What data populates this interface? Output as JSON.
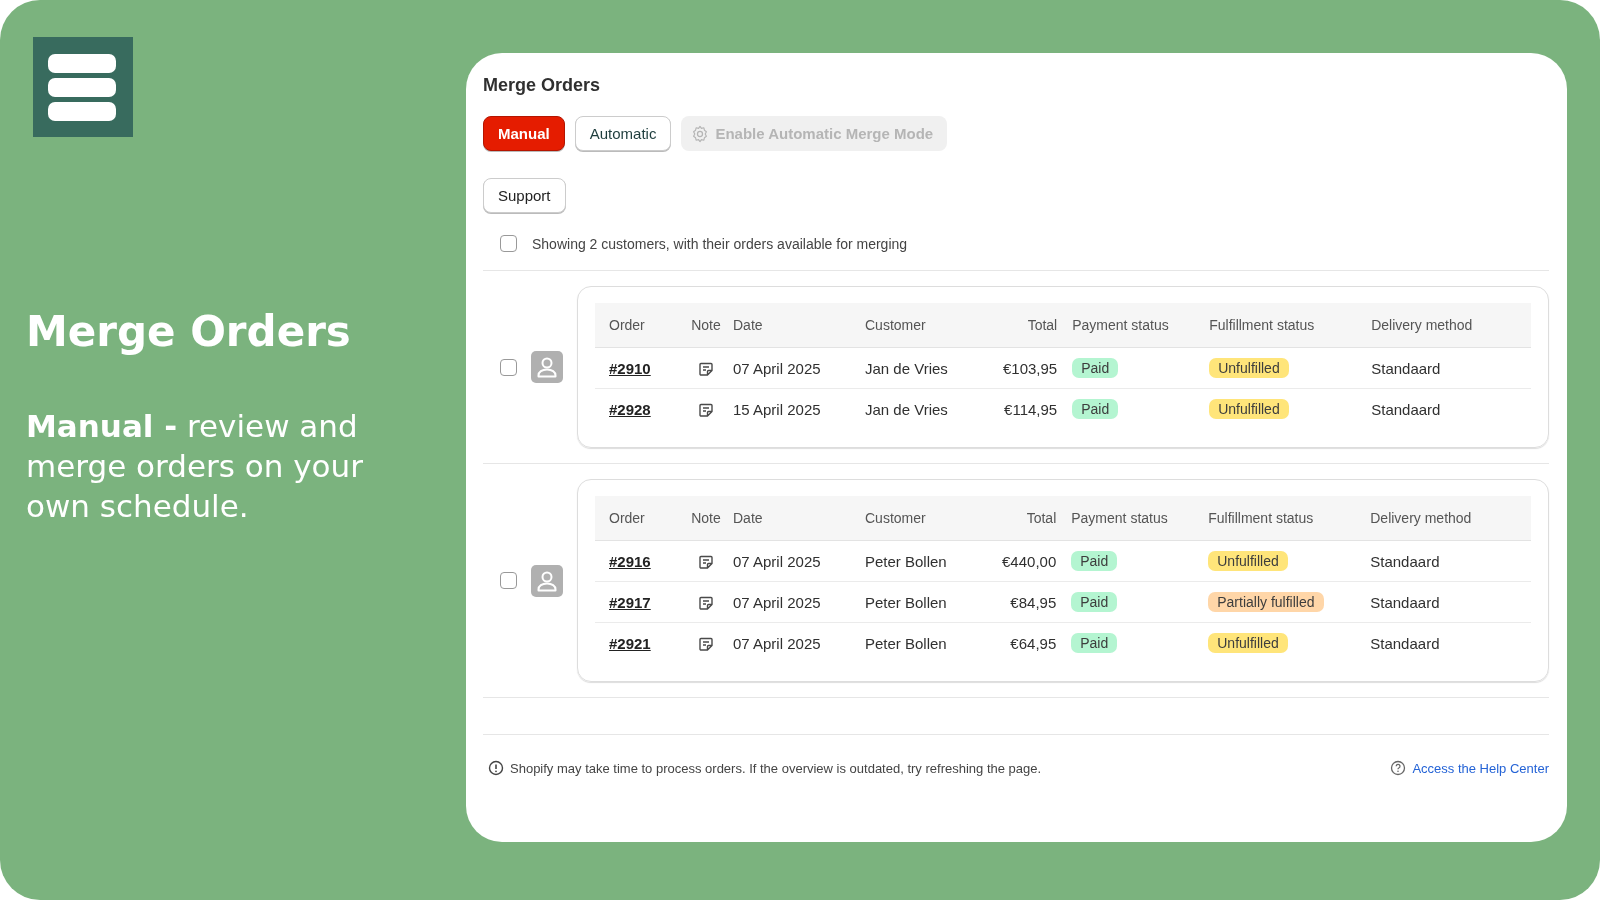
{
  "promo": {
    "title": "Merge Orders",
    "description": "**Manual -** review and merge orders on your own schedule."
  },
  "panel": {
    "title": "Merge Orders",
    "tabs": [
      {
        "label": "Manual",
        "selected": true
      },
      {
        "label": "Automatic",
        "selected": false
      }
    ],
    "enable_button": {
      "label": "Enable Automatic Merge Mode",
      "disabled": true
    },
    "support_button": "Support",
    "select_all": {
      "label": "Showing 2 customers, with their orders available for merging",
      "checked": false
    },
    "groups": [
      {
        "checked": false,
        "columns": [
          "Order",
          "Note",
          "Date",
          "Customer",
          "Total",
          "Payment status",
          "Fulfillment status",
          "Delivery method"
        ],
        "orders": [
          {
            "order": "#2910",
            "date": "07 April 2025",
            "customer": "Jan de Vries",
            "total": "€103,95",
            "payment": {
              "label": "Paid",
              "color": "#b4f5d1"
            },
            "fulfillment": {
              "label": "Unfulfilled",
              "color": "#ffe57a"
            },
            "delivery": "Standaard"
          },
          {
            "order": "#2928",
            "date": "15 April 2025",
            "customer": "Jan de Vries",
            "total": "€114,95",
            "payment": {
              "label": "Paid",
              "color": "#b4f5d1"
            },
            "fulfillment": {
              "label": "Unfulfilled",
              "color": "#ffe57a"
            },
            "delivery": "Standaard"
          }
        ]
      },
      {
        "checked": false,
        "columns": [
          "Order",
          "Note",
          "Date",
          "Customer",
          "Total",
          "Payment status",
          "Fulfillment status",
          "Delivery method"
        ],
        "orders": [
          {
            "order": "#2916",
            "date": "07 April 2025",
            "customer": "Peter Bollen",
            "total": "€440,00",
            "payment": {
              "label": "Paid",
              "color": "#b4f5d1"
            },
            "fulfillment": {
              "label": "Unfulfilled",
              "color": "#ffe57a"
            },
            "delivery": "Standaard"
          },
          {
            "order": "#2917",
            "date": "07 April 2025",
            "customer": "Peter Bollen",
            "total": "€84,95",
            "payment": {
              "label": "Paid",
              "color": "#b4f5d1"
            },
            "fulfillment": {
              "label": "Partially fulfilled",
              "color": "#ffd6a8"
            },
            "delivery": "Standaard"
          },
          {
            "order": "#2921",
            "date": "07 April 2025",
            "customer": "Peter Bollen",
            "total": "€64,95",
            "payment": {
              "label": "Paid",
              "color": "#b4f5d1"
            },
            "fulfillment": {
              "label": "Unfulfilled",
              "color": "#ffe57a"
            },
            "delivery": "Standaard"
          }
        ]
      }
    ],
    "footer": {
      "notice": "Shopify may take time to process orders. If the overview is outdated, try refreshing the page.",
      "help_link": "Access the Help Center"
    }
  }
}
